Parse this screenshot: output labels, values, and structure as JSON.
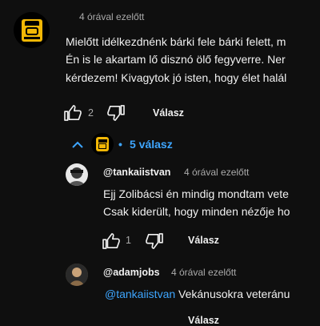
{
  "comment": {
    "time": "4 órával ezelőtt",
    "lines": [
      "Mielőtt idélkezdnénk bárki fele bárki felett, m",
      "Én is le akartam lő disznó ölő fegyverre. Ner",
      "kérdezem! Kivagytok jó isten, hogy élet halál"
    ],
    "likes": "2",
    "reply_label": "Válasz"
  },
  "replies_toggle": {
    "dot": "•",
    "label": "5 válasz"
  },
  "replies": [
    {
      "author": "@tankaiistvan",
      "time": "4 órával ezelőtt",
      "lines": [
        "Ejj Zolibácsi én mindig mondtam vete",
        "Csak kiderült, hogy minden nézője  ho"
      ],
      "likes": "1",
      "reply_label": "Válasz"
    },
    {
      "author": "@adamjobs",
      "time": "4 órával ezelőtt",
      "mention": "@tankaiistvan",
      "text": " Vekánusokra veteránu",
      "reply_label": "Válasz"
    }
  ],
  "colors": {
    "background": "#0f0f0f",
    "link": "#3ea6ff",
    "muted": "#aaaaaa",
    "badge": "#f2b705"
  },
  "icons": [
    "thumbs-up-icon",
    "thumbs-down-icon",
    "chevron-up-icon"
  ]
}
